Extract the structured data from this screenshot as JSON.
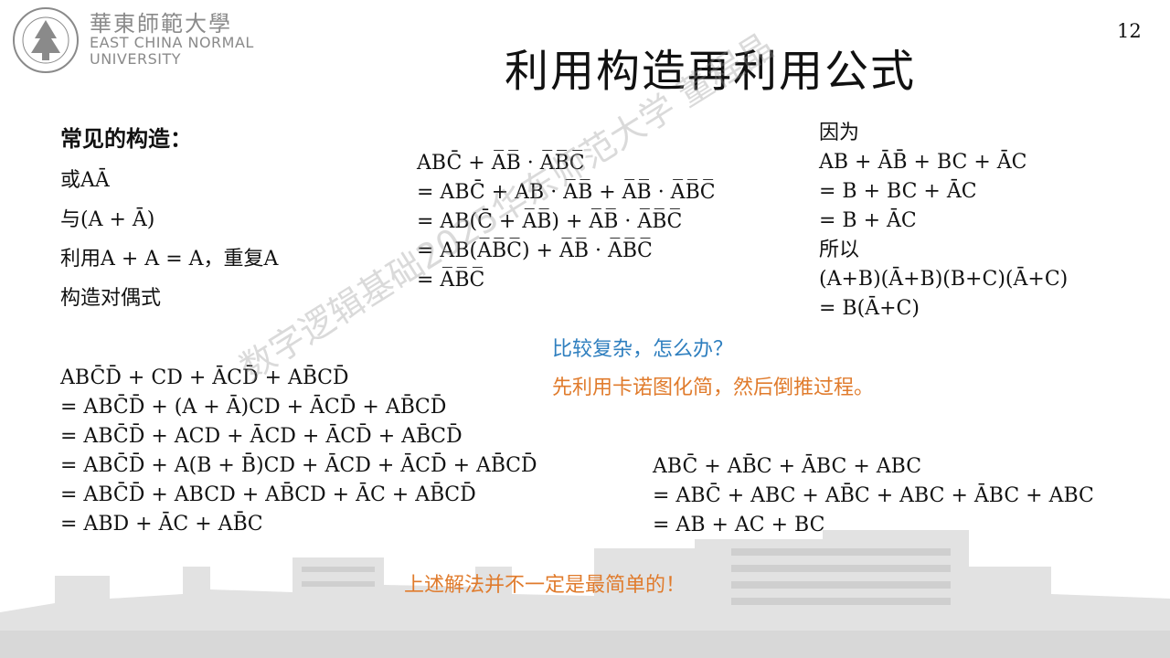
{
  "header": {
    "university_cn": "華東師範大學",
    "university_en_line1": "EAST CHINA NORMAL",
    "university_en_line2": "UNIVERSITY",
    "page_number": "12"
  },
  "title": "利用构造再利用公式",
  "construct": {
    "heading": "常见的构造：",
    "items": [
      "或AĀ",
      "与(A + Ā)",
      "利用A + A = A，重复A",
      "构造对偶式"
    ]
  },
  "derivation_middle": [
    "ABC̄ + A̅B̅ · A̅B̅C̅",
    "= ABC̄ + AB · A̅B̅ + A̅B̅ · A̅B̅C̅",
    "= AB(C̄ + A̅B̅) + A̅B̅ · A̅B̅C̅",
    "= AB(A̅B̅C̅) + A̅B̅ · A̅B̅C̅",
    "= A̅B̅C̅"
  ],
  "derivation_right": [
    "因为",
    "AB + ĀB̄ + BC + ĀC",
    "= B + BC + ĀC",
    "= B + ĀC",
    "所以",
    "(A+B)(Ā+B)(B+C)(Ā+C)",
    "= B(Ā+C)"
  ],
  "notes": {
    "question": "比较复杂，怎么办？",
    "answer": "先利用卡诺图化简，然后倒推过程。",
    "bottom": "上述解法并不一定是最简单的！"
  },
  "derivation_bottom_left": [
    "ABC̄D̄ + CD + ĀCD̄ + AB̄CD̄",
    "= ABC̄D̄ + (A + Ā)CD + ĀCD̄ + AB̄CD̄",
    "= ABC̄D̄ + ACD + ĀCD + ĀCD̄ + AB̄CD̄",
    "= ABC̄D̄ + A(B + B̄)CD + ĀCD + ĀCD̄ + AB̄CD̄",
    "= ABC̄D̄ + ABCD + AB̄CD + ĀC + AB̄CD̄",
    "= ABD + ĀC + AB̄C"
  ],
  "derivation_bottom_right": [
    "ABC̄ + AB̄C + ĀBC + ABC",
    "= ABC̄ + ABC + AB̄C + ABC + ĀBC + ABC",
    "= AB + AC + BC"
  ],
  "watermark": "数字逻辑基础2025华东师范大学 董程晶",
  "colors": {
    "blue": "#2f7fbf",
    "orange": "#e07b2c",
    "gray": "#8a8a8a"
  }
}
